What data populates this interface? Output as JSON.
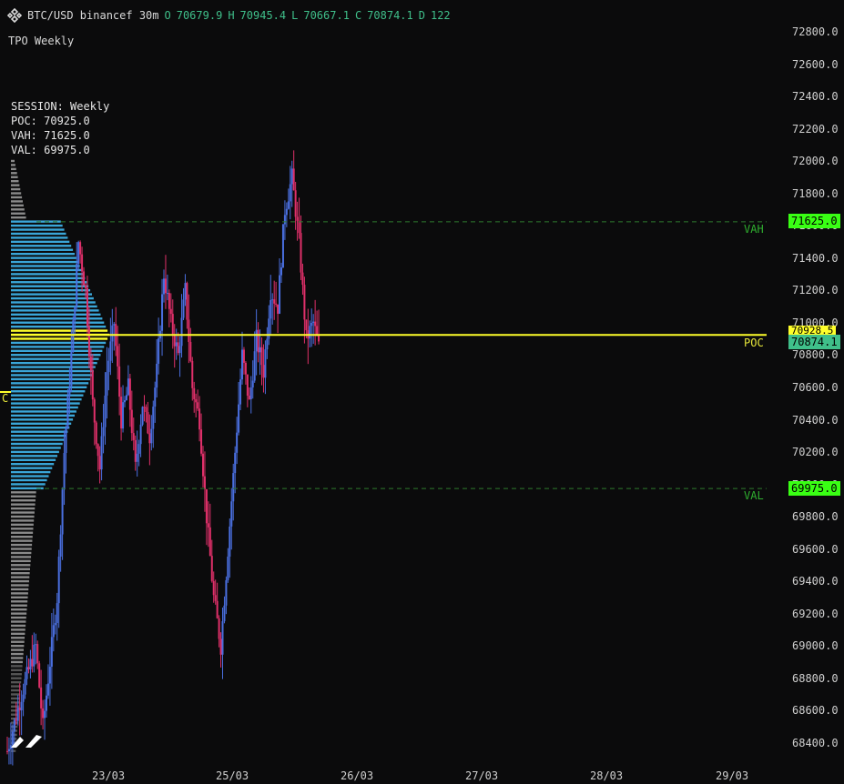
{
  "header": {
    "symbol": "BTC/USD binancef 30m",
    "o_label": "O",
    "o_value": "70679.9",
    "h_label": "H",
    "h_value": "70945.4",
    "l_label": "L",
    "l_value": "70667.1",
    "c_label": "C",
    "c_value": "70874.1",
    "d_label": "D",
    "d_value": "122"
  },
  "subtitle": "TPO Weekly",
  "stats": {
    "session": "SESSION: Weekly",
    "poc": "POC: 70925.0",
    "vah": "VAH: 71625.0",
    "val": "VAL: 69975.0"
  },
  "levels": {
    "vah_label": "VAH",
    "val_label": "VAL",
    "poc_label": "POC",
    "c_label": "C",
    "vah_tag": "71625.0",
    "val_tag": "69975.0",
    "poc_tag": "70928.5",
    "last_tag": "70874.1"
  },
  "colors": {
    "background": "#0b0b0c",
    "up": "#4a6fe0",
    "down": "#e0306a",
    "poc": "#ffff2a",
    "value_area": "#3aa6d8",
    "profile_out": "#8a8a8a",
    "level_line": "#2e7a2e",
    "level_tag": "#39ff14",
    "last_tag": "#3fbf8a"
  },
  "chart_data": {
    "type": "candlestick",
    "title": "BTC/USD binancef 30m",
    "yaxis": {
      "ticks": [
        "72800.0",
        "72600.0",
        "72400.0",
        "72200.0",
        "72000.0",
        "71800.0",
        "71600.0",
        "71400.0",
        "71200.0",
        "71000.0",
        "70800.0",
        "70600.0",
        "70400.0",
        "70200.0",
        "70000.0",
        "69800.0",
        "69600.0",
        "69400.0",
        "69200.0",
        "69000.0",
        "68800.0",
        "68600.0",
        "68400.0"
      ]
    },
    "xaxis": {
      "ticks": [
        "23/03",
        "25/03",
        "26/03",
        "27/03",
        "28/03",
        "29/03"
      ]
    },
    "levels": {
      "poc": 70925.0,
      "vah": 71625.0,
      "val": 69975.0,
      "last": 70874.1
    },
    "tpo_profile_note": "blue = value area, yellow = POC, grey = outside value area",
    "price_path": [
      [
        0,
        68350
      ],
      [
        4,
        68700
      ],
      [
        8,
        69000
      ],
      [
        10,
        68500
      ],
      [
        14,
        69300
      ],
      [
        16,
        70200
      ],
      [
        18,
        70800
      ],
      [
        20,
        71500
      ],
      [
        22,
        71200
      ],
      [
        24,
        70500
      ],
      [
        26,
        70100
      ],
      [
        28,
        70700
      ],
      [
        30,
        71000
      ],
      [
        32,
        70400
      ],
      [
        34,
        70600
      ],
      [
        36,
        70100
      ],
      [
        38,
        70500
      ],
      [
        40,
        70300
      ],
      [
        42,
        70700
      ],
      [
        44,
        71300
      ],
      [
        46,
        71000
      ],
      [
        48,
        70800
      ],
      [
        50,
        71200
      ],
      [
        52,
        70600
      ],
      [
        54,
        70400
      ],
      [
        56,
        69800
      ],
      [
        58,
        69300
      ],
      [
        60,
        69000
      ],
      [
        62,
        69600
      ],
      [
        64,
        70200
      ],
      [
        66,
        70800
      ],
      [
        68,
        70500
      ],
      [
        70,
        70900
      ],
      [
        72,
        70700
      ],
      [
        74,
        71200
      ],
      [
        76,
        71100
      ],
      [
        78,
        71700
      ],
      [
        80,
        71900
      ],
      [
        82,
        71500
      ],
      [
        84,
        70900
      ],
      [
        86,
        71000
      ],
      [
        88,
        70800
      ]
    ]
  }
}
